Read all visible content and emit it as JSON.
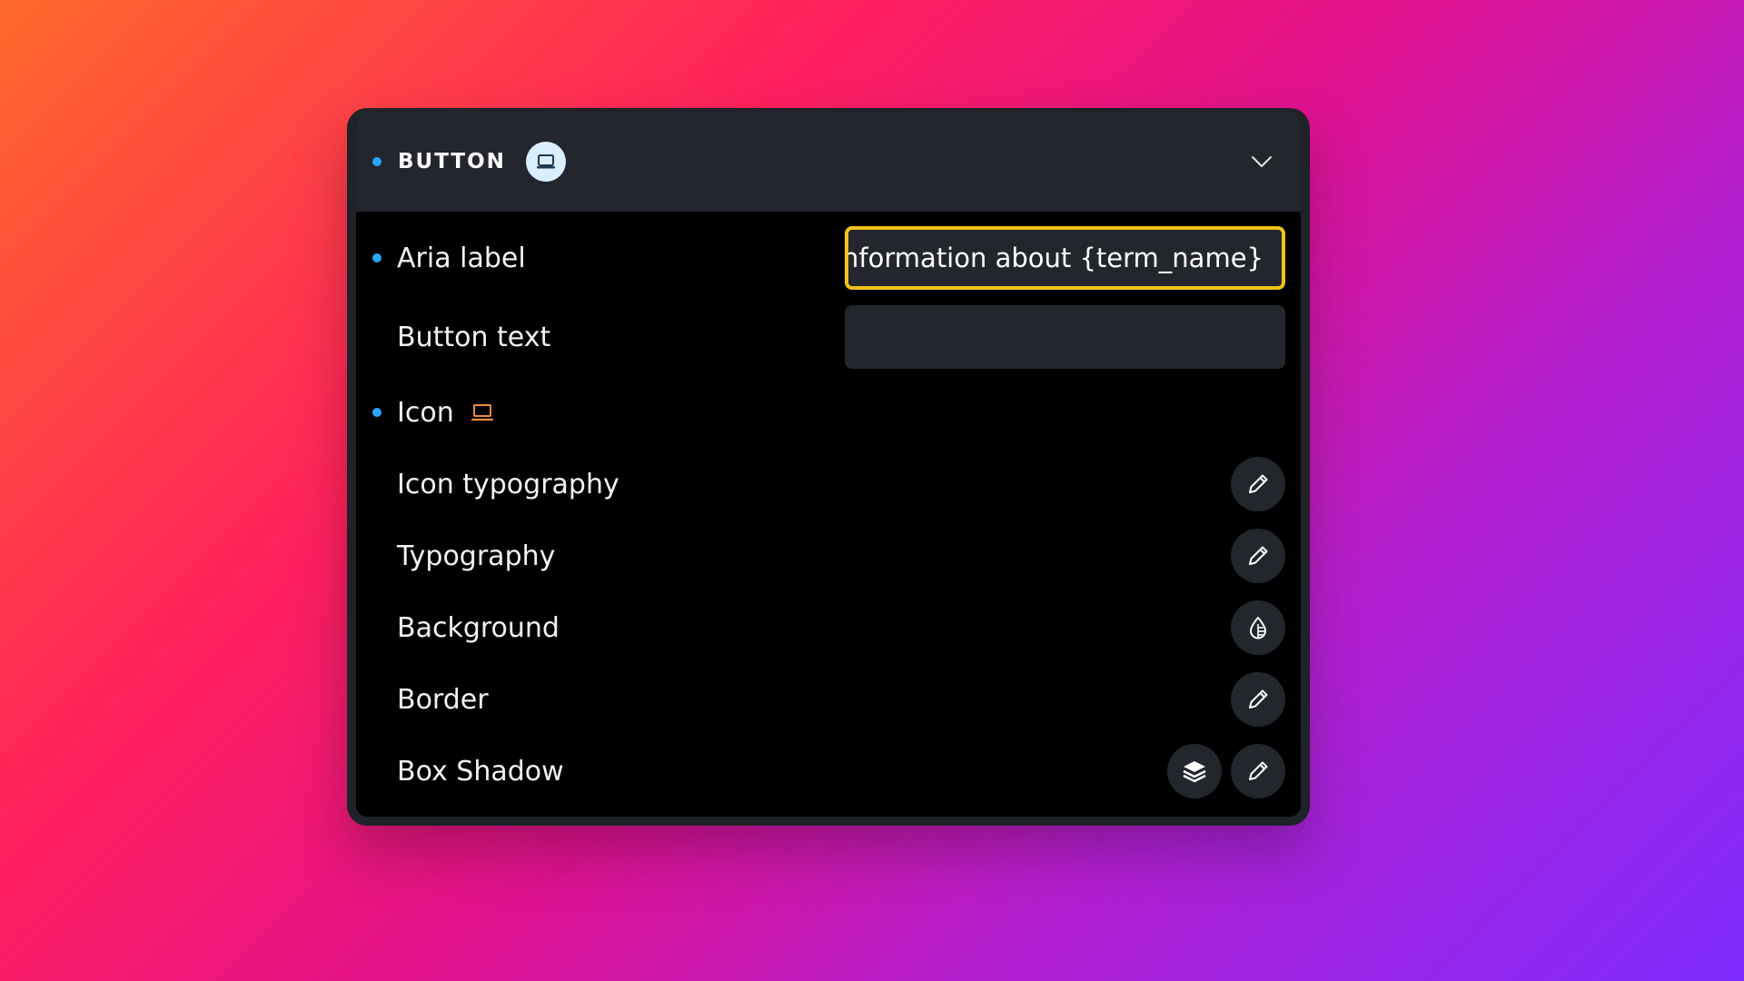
{
  "panel": {
    "title": "BUTTON",
    "title_badge_icon": "laptop-icon",
    "collapse_icon": "chevron-down-icon"
  },
  "rows": {
    "aria_label": {
      "label": "Aria label",
      "value": "nformation about {term_name}",
      "modified": true
    },
    "button_text": {
      "label": "Button text",
      "value": ""
    },
    "icon": {
      "label": "Icon",
      "icon": "laptop-icon",
      "modified": true
    },
    "icon_typography": {
      "label": "Icon typography",
      "action_icon": "pencil-icon"
    },
    "typography": {
      "label": "Typography",
      "action_icon": "pencil-icon"
    },
    "background": {
      "label": "Background",
      "action_icon": "droplet-icon"
    },
    "border": {
      "label": "Border",
      "action_icon": "pencil-icon"
    },
    "box_shadow": {
      "label": "Box Shadow",
      "action_icons": [
        "layers-icon",
        "pencil-icon"
      ]
    }
  },
  "colors": {
    "modified_dot": "#2aa6ff",
    "focus_border": "#f2c21b",
    "inline_icon": "#f08a3c",
    "panel_header": "#23262d"
  }
}
